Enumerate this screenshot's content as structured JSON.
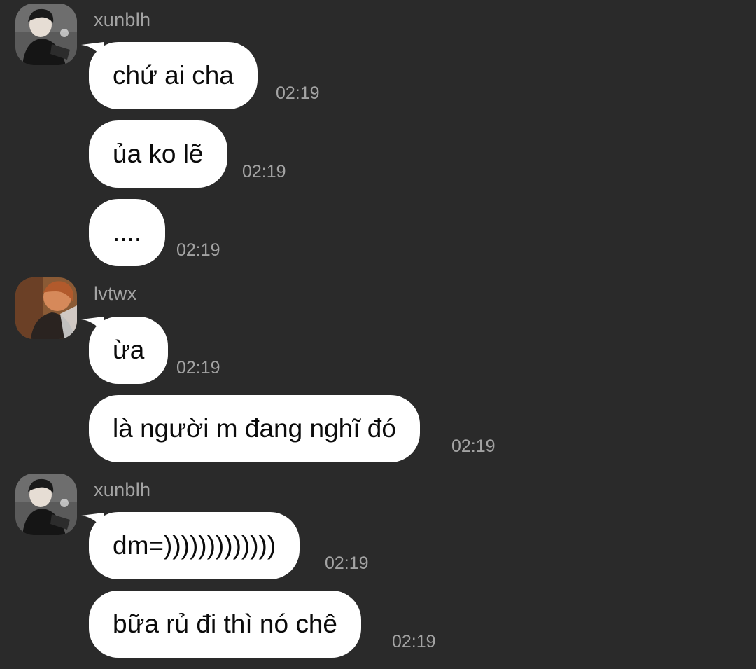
{
  "messages": [
    {
      "sender": "xunblh",
      "text": "chứ ai cha",
      "time": "02:19"
    },
    {
      "sender": "xunblh",
      "text": "ủa ko lẽ",
      "time": "02:19"
    },
    {
      "sender": "xunblh",
      "text": "....",
      "time": "02:19"
    },
    {
      "sender": "lvtwx",
      "text": "ừa",
      "time": "02:19"
    },
    {
      "sender": "lvtwx",
      "text": "là người m đang nghĩ đó",
      "time": "02:19"
    },
    {
      "sender": "xunblh",
      "text": "dm=)))))))))))))",
      "time": "02:19"
    },
    {
      "sender": "xunblh",
      "text": "bữa rủ đi thì nó chê",
      "time": "02:19"
    }
  ],
  "theme": {
    "background": "#2a2a2a",
    "bubble": "#ffffff",
    "meta_text": "#a3a3a3"
  }
}
